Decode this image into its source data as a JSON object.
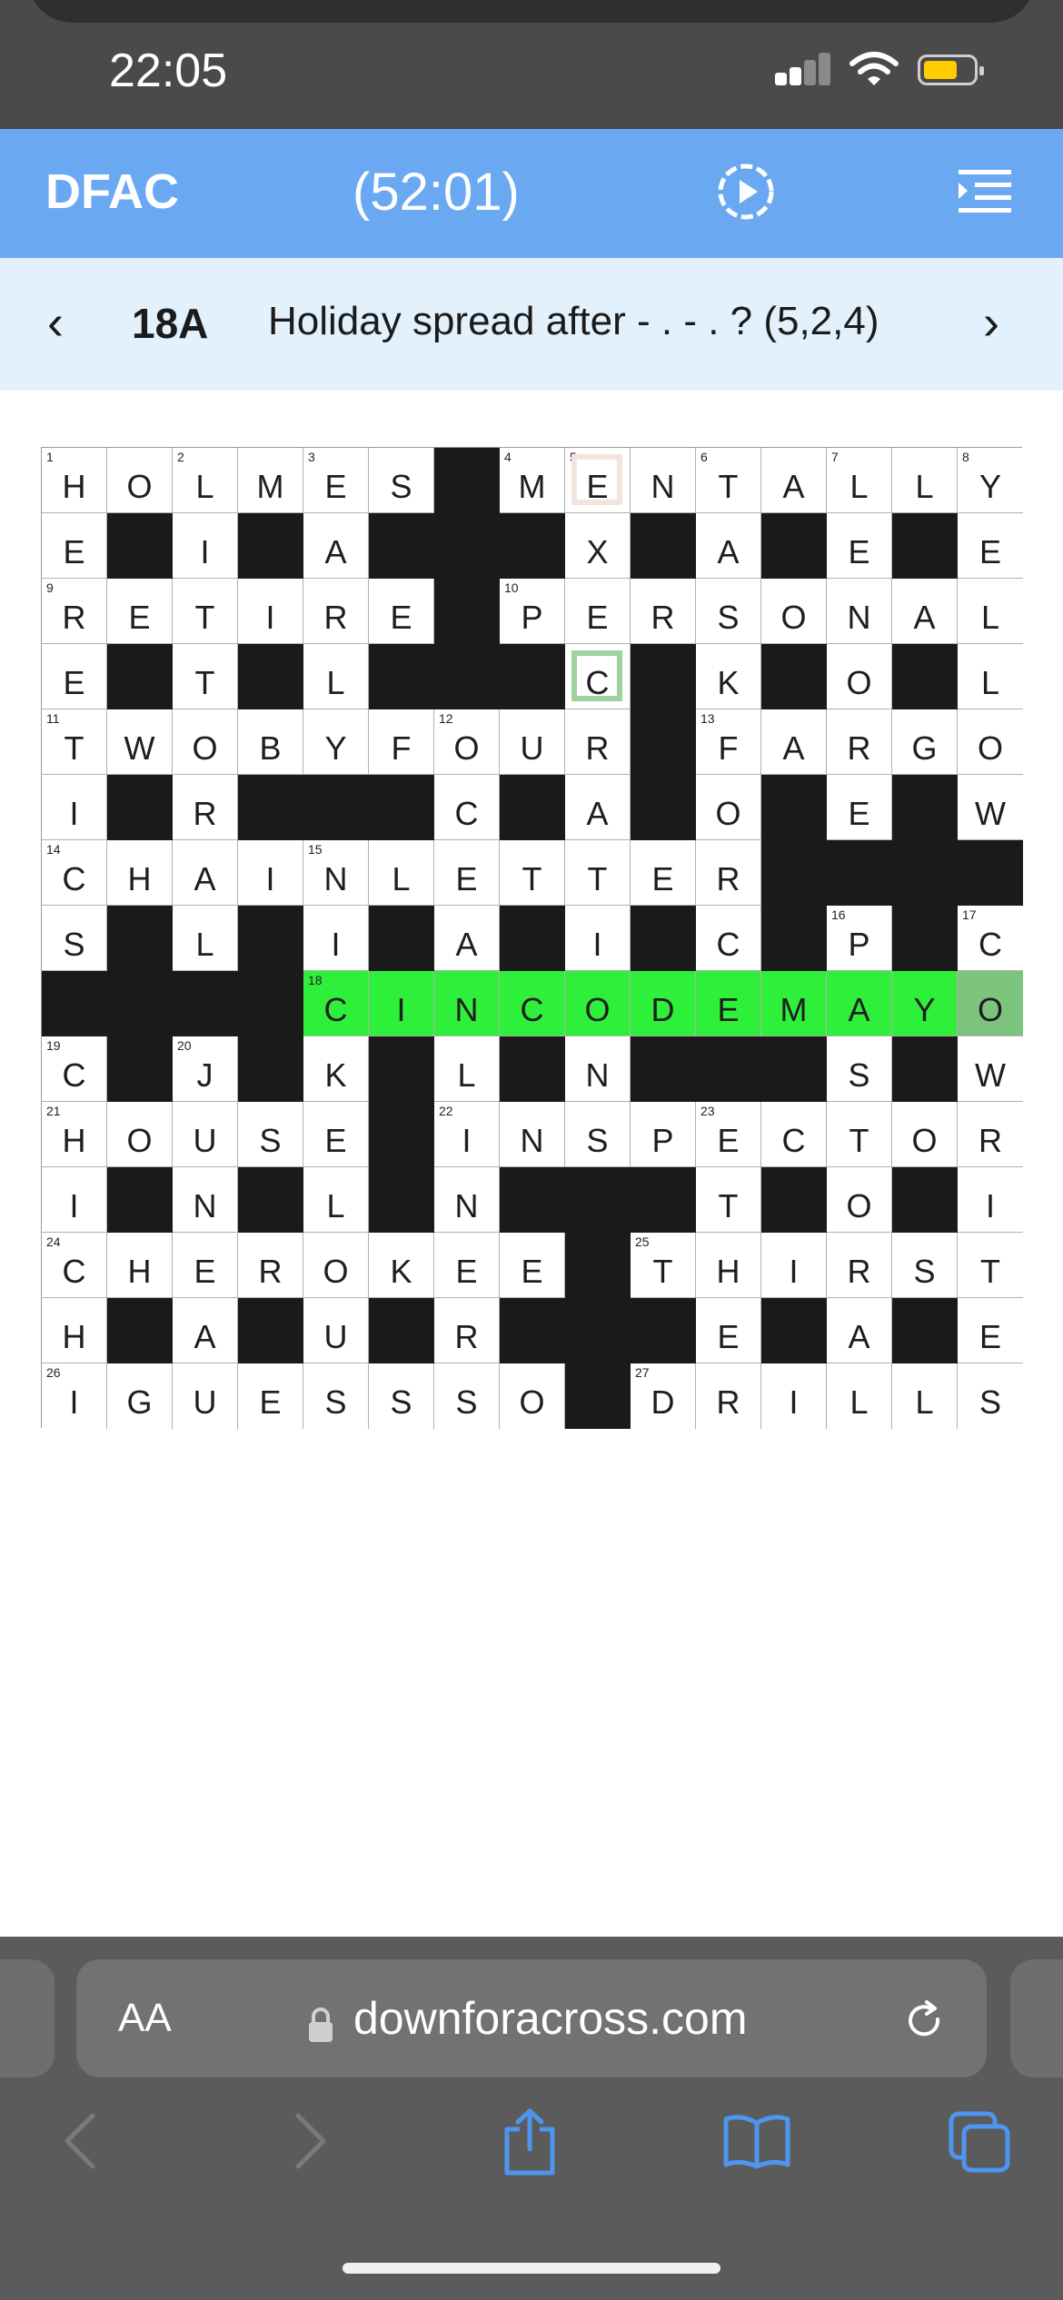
{
  "status": {
    "time": "22:05"
  },
  "app": {
    "brand": "DFAC",
    "timer": "(52:01)"
  },
  "clue": {
    "prev": "‹",
    "number": "18A",
    "text": "Holiday spread after - . - . ? (5,2,4)",
    "next": "›"
  },
  "grid": {
    "size": 15,
    "rows": [
      "HOLMES#MENTALLY",
      "E#I#A###X#A#E#E",
      "RETIRE#PERSONAL",
      "E#T#L###C#K#O#L",
      "TWOBYFOUR#FARGO",
      "I#R###C#A#O#E#W",
      "CHAINLETTER####",
      "S#L#I#A#I#C#P#C",
      "####CINCODEMAYO",
      "C#J#K#L#N###S#W",
      "HOUSE#INSPECTOR",
      "I#N#L#N###T#O#I",
      "CHEROKEE#THIRST",
      "H#A#U#R###E#A#E",
      "IGUESSSO#DRILLS"
    ],
    "numbers": [
      {
        "r": 0,
        "c": 0,
        "n": "1"
      },
      {
        "r": 0,
        "c": 2,
        "n": "2"
      },
      {
        "r": 0,
        "c": 4,
        "n": "3"
      },
      {
        "r": 0,
        "c": 7,
        "n": "4"
      },
      {
        "r": 0,
        "c": 8,
        "n": "5"
      },
      {
        "r": 0,
        "c": 10,
        "n": "6"
      },
      {
        "r": 0,
        "c": 12,
        "n": "7"
      },
      {
        "r": 0,
        "c": 14,
        "n": "8"
      },
      {
        "r": 2,
        "c": 0,
        "n": "9"
      },
      {
        "r": 2,
        "c": 7,
        "n": "10"
      },
      {
        "r": 4,
        "c": 0,
        "n": "11"
      },
      {
        "r": 4,
        "c": 6,
        "n": "12"
      },
      {
        "r": 4,
        "c": 10,
        "n": "13"
      },
      {
        "r": 6,
        "c": 0,
        "n": "14"
      },
      {
        "r": 6,
        "c": 4,
        "n": "15"
      },
      {
        "r": 7,
        "c": 12,
        "n": "16"
      },
      {
        "r": 7,
        "c": 14,
        "n": "17"
      },
      {
        "r": 8,
        "c": 4,
        "n": "18"
      },
      {
        "r": 9,
        "c": 0,
        "n": "19"
      },
      {
        "r": 9,
        "c": 2,
        "n": "20"
      },
      {
        "r": 10,
        "c": 0,
        "n": "21"
      },
      {
        "r": 10,
        "c": 6,
        "n": "22"
      },
      {
        "r": 10,
        "c": 10,
        "n": "23"
      },
      {
        "r": 12,
        "c": 0,
        "n": "24"
      },
      {
        "r": 12,
        "c": 9,
        "n": "25"
      },
      {
        "r": 14,
        "c": 0,
        "n": "26"
      },
      {
        "r": 14,
        "c": 9,
        "n": "27"
      }
    ],
    "highlight": {
      "row": 8,
      "from": 4,
      "to": 14
    },
    "selected": {
      "r": 8,
      "c": 14
    },
    "pencil_cells": [
      {
        "r": 0,
        "c": 8
      }
    ],
    "revealed_cells": [
      {
        "r": 3,
        "c": 8
      }
    ]
  },
  "browser": {
    "aa_label": "AA",
    "url": "downforacross.com"
  }
}
